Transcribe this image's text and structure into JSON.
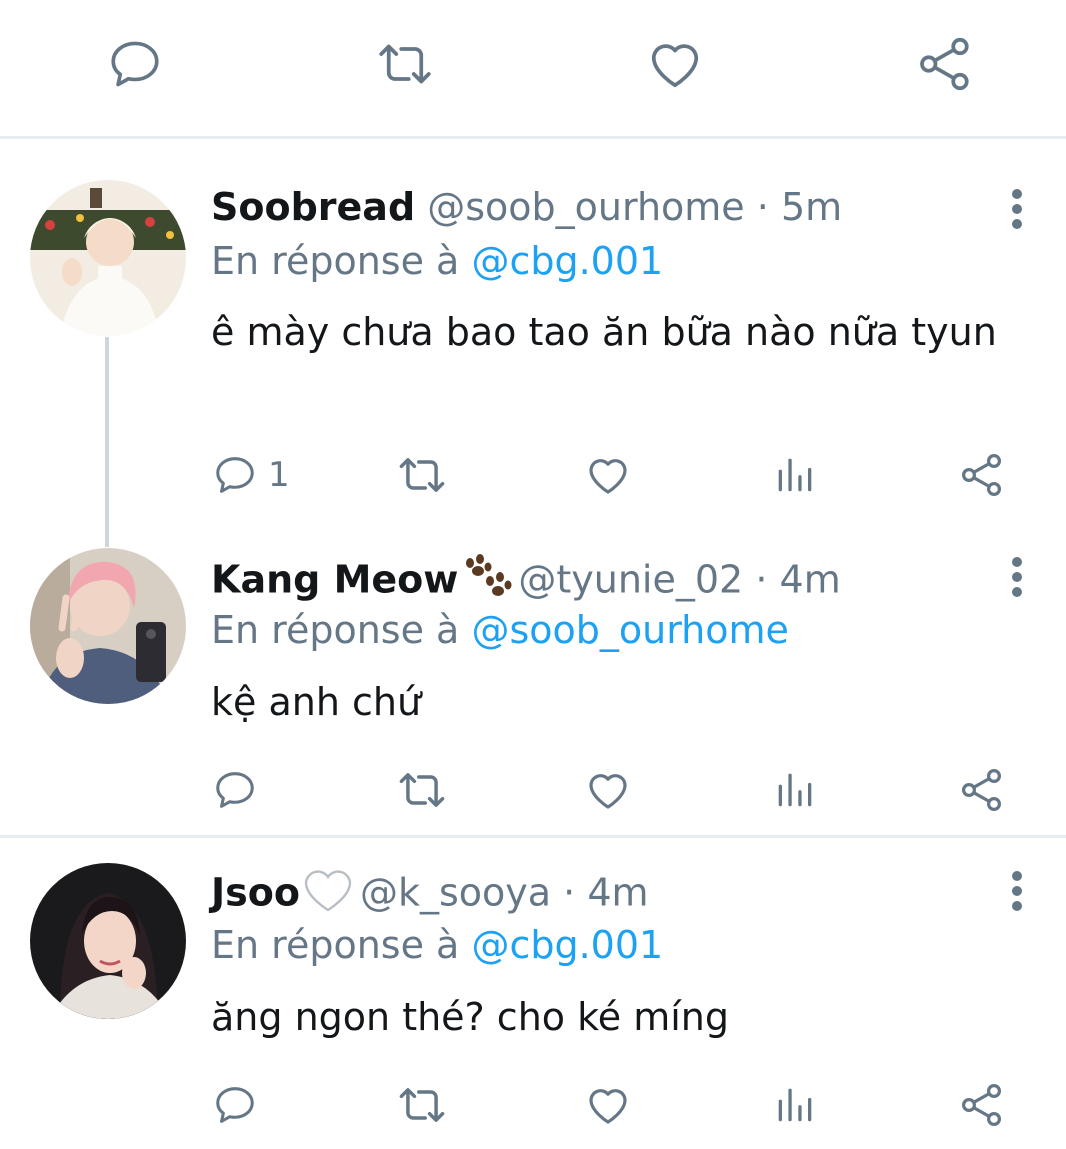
{
  "top_actions": {
    "icons": [
      "reply-icon",
      "retweet-icon",
      "like-icon",
      "share-icon"
    ]
  },
  "tweets": [
    {
      "name": "Soobread",
      "handle": "@soob_ourhome",
      "separator": "·",
      "time": "5m",
      "reply_prefix": "En réponse à",
      "reply_mention": "@cbg.001",
      "text": "ê mày chưa bao tao ăn bữa nào nữa tyun",
      "reply_count": "1"
    },
    {
      "name": "Kang Meow",
      "name_emoji": "paw-prints-emoji",
      "handle": "@tyunie_02",
      "separator": "·",
      "time": "4m",
      "reply_prefix": "En réponse à",
      "reply_mention": "@soob_ourhome",
      "text": "kệ anh chứ",
      "reply_count": ""
    },
    {
      "name": "Jsoo",
      "name_emoji": "white-heart-emoji",
      "handle": "@k_sooya",
      "separator": "·",
      "time": "4m",
      "reply_prefix": "En réponse à",
      "reply_mention": "@cbg.001",
      "text": "ăng ngon thé? cho ké míng",
      "reply_count": ""
    }
  ],
  "colors": {
    "icon_gray": "#657786",
    "mention_blue": "#1da1f2",
    "divider": "#e6ecf0",
    "thread_line": "#ccd6dd",
    "text": "#14171a"
  }
}
